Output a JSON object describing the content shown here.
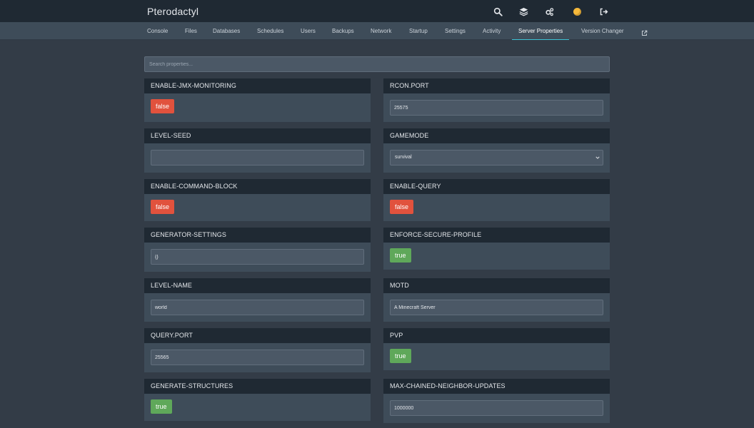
{
  "app": {
    "title": "Pterodactyl"
  },
  "topbar": {
    "icons": [
      "search-icon",
      "layers-icon",
      "cogs-icon",
      "avatar-icon",
      "sign-out-icon"
    ]
  },
  "nav": {
    "items": [
      {
        "label": "Console"
      },
      {
        "label": "Files"
      },
      {
        "label": "Databases"
      },
      {
        "label": "Schedules"
      },
      {
        "label": "Users"
      },
      {
        "label": "Backups"
      },
      {
        "label": "Network"
      },
      {
        "label": "Startup"
      },
      {
        "label": "Settings"
      },
      {
        "label": "Activity"
      },
      {
        "label": "Server Properties",
        "active": true
      },
      {
        "label": "Version Changer"
      }
    ],
    "external_icon": "external-link-icon",
    "accent": "#3ec1d3"
  },
  "search": {
    "placeholder": "Search properties...",
    "value": ""
  },
  "properties": {
    "enable_jmx_monitoring": {
      "name": "ENABLE-JMX-MONITORING",
      "value": "false"
    },
    "rcon_port": {
      "name": "RCON.PORT",
      "value": "25575"
    },
    "level_seed": {
      "name": "LEVEL-SEED",
      "value": ""
    },
    "gamemode": {
      "name": "GAMEMODE",
      "value": "survival"
    },
    "enable_command_block": {
      "name": "ENABLE-COMMAND-BLOCK",
      "value": "false"
    },
    "enable_query": {
      "name": "ENABLE-QUERY",
      "value": "false"
    },
    "generator_settings": {
      "name": "GENERATOR-SETTINGS",
      "value": "{}"
    },
    "enforce_secure_profile": {
      "name": "ENFORCE-SECURE-PROFILE",
      "value": "true"
    },
    "level_name": {
      "name": "LEVEL-NAME",
      "value": "world"
    },
    "motd": {
      "name": "MOTD",
      "value": "A Minecraft Server"
    },
    "query_port": {
      "name": "QUERY.PORT",
      "value": "25565"
    },
    "pvp": {
      "name": "PVP",
      "value": "true"
    },
    "generate_structures": {
      "name": "GENERATE-STRUCTURES",
      "value": "true"
    },
    "max_chained_neighbor_updates": {
      "name": "MAX-CHAINED-NEIGHBOR-UPDATES",
      "value": "1000000"
    }
  },
  "colors": {
    "false": "#e1523d",
    "true": "#5fa85a",
    "background": "#333c47",
    "header": "#1f2933"
  }
}
